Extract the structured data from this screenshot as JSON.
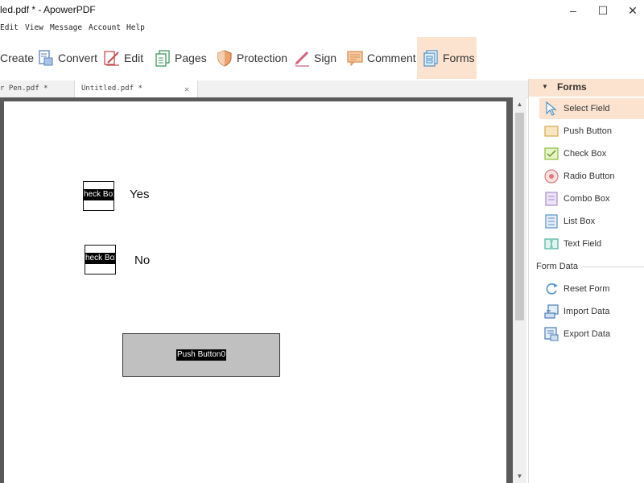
{
  "titlebar": {
    "title": "led.pdf * - ApowerPDF",
    "minimize": "–",
    "maximize": "☐",
    "close": "✕"
  },
  "menubar": {
    "items": [
      "Edit",
      "View",
      "Message",
      "Account",
      "Help"
    ]
  },
  "toolbar": {
    "buttons": [
      {
        "label": "Create",
        "icon": "create-icon"
      },
      {
        "label": "Convert",
        "icon": "convert-icon"
      },
      {
        "label": "Edit",
        "icon": "edit-icon"
      },
      {
        "label": "Pages",
        "icon": "pages-icon"
      },
      {
        "label": "Protection",
        "icon": "shield-icon"
      },
      {
        "label": "Sign",
        "icon": "pen-icon"
      },
      {
        "label": "Comment",
        "icon": "comment-icon"
      },
      {
        "label": "Forms",
        "icon": "forms-icon"
      }
    ],
    "active": "Forms",
    "active_color": "#fbe3cf"
  },
  "tabs": [
    {
      "label": "r Pen.pdf *"
    },
    {
      "label": "Untitled.pdf *",
      "close": "✕"
    }
  ],
  "document": {
    "checkbox_yes": {
      "field_label": "heck Box",
      "text": "Yes"
    },
    "checkbox_no": {
      "field_label": "heck Box",
      "text": "No"
    },
    "push_button": {
      "label": "Push Button0"
    }
  },
  "panel": {
    "title": "Forms",
    "form_items": [
      {
        "label": "Select Field",
        "icon": "cursor-arrow-icon",
        "selected": true
      },
      {
        "label": "Push Button",
        "icon": "push-button-icon"
      },
      {
        "label": "Check Box",
        "icon": "check-box-icon"
      },
      {
        "label": "Radio Button",
        "icon": "radio-button-icon"
      },
      {
        "label": "Combo Box",
        "icon": "combo-box-icon"
      },
      {
        "label": "List Box",
        "icon": "list-box-icon"
      },
      {
        "label": "Text Field",
        "icon": "text-field-icon"
      }
    ],
    "form_data_title": "Form Data",
    "form_data_items": [
      {
        "label": "Reset Form",
        "icon": "reset-icon"
      },
      {
        "label": "Import Data",
        "icon": "import-icon"
      },
      {
        "label": "Export Data",
        "icon": "export-icon"
      }
    ]
  }
}
